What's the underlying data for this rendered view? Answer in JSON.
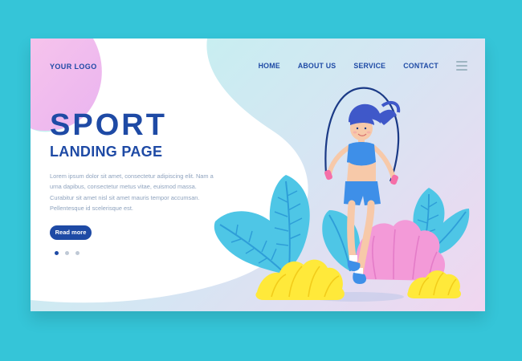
{
  "header": {
    "logo": "YOUR LOGO",
    "nav": [
      "HOME",
      "ABOUT US",
      "SERVICE",
      "CONTACT"
    ],
    "menu_icon": "hamburger-icon"
  },
  "hero": {
    "title": "SPORT",
    "subtitle": "LANDING PAGE",
    "body": "Lorem ipsum dolor sit amet, consectetur adipiscing elit. Nam a urna dapibus, consectetur metus vitae, euismod massa. Curabitur sit amet nisl sit amet mauris tempor accumsan. Pellentesque id scelerisque est.",
    "button_label": "Read more",
    "slides": {
      "count": 3,
      "active": 1
    }
  },
  "illustration": {
    "subject": "woman-jumping-rope",
    "colors": {
      "primary": "#1E4AA5",
      "accent_blue": "#3E8FE8",
      "leaf_blue": "#4EC6E6",
      "pink": "#F39AD8",
      "yellow": "#FFE93A",
      "background": "#35C5D8"
    }
  }
}
